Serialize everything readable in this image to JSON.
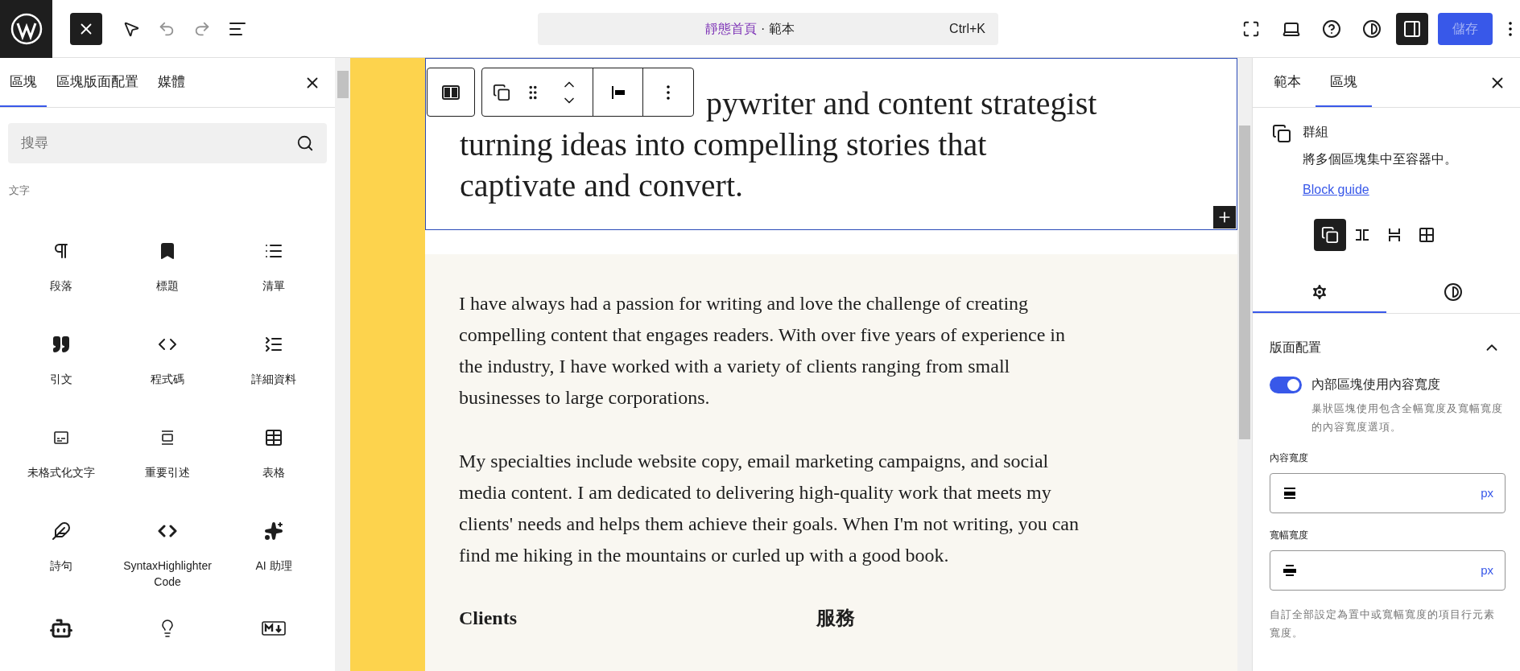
{
  "top_bar": {
    "command": {
      "page": "靜態首頁",
      "separator": " · ",
      "type": "範本",
      "shortcut": "Ctrl+K"
    },
    "save_button": {
      "label": "儲存",
      "disabled": true
    },
    "sidebar_open": true
  },
  "inserter": {
    "tabs": [
      {
        "label": "區塊",
        "selected": true
      },
      {
        "label": "區塊版面配置",
        "selected": false
      },
      {
        "label": "媒體",
        "selected": false
      }
    ],
    "search": {
      "placeholder": "搜尋"
    },
    "category": "文字",
    "blocks": [
      {
        "label": "段落"
      },
      {
        "label": "標題"
      },
      {
        "label": "清單"
      },
      {
        "label": "引文"
      },
      {
        "label": "程式碼"
      },
      {
        "label": "詳細資料"
      },
      {
        "label": "未格式化文字"
      },
      {
        "label": "重要引述"
      },
      {
        "label": "表格"
      },
      {
        "label": "詩句"
      },
      {
        "label": "SyntaxHighlighter Code"
      },
      {
        "label": "AI 助理"
      }
    ]
  },
  "canvas": {
    "heading_lines": [
      "pywriter and content strategist",
      "turning ideas into compelling stories that",
      "captivate and convert."
    ],
    "paragraphs": [
      "I have always had a passion for writing and love the challenge of creating compelling content that engages readers. With over five years of experience in the industry, I have worked with a variety of clients ranging from small businesses to large corporations.",
      "My specialties include website copy, email marketing campaigns, and social media content. I am dedicated to delivering high-quality work that meets my clients' needs and helps them achieve their goals. When I'm not writing, you can find me hiking in the mountains or curled up with a good book."
    ],
    "column_headings": [
      "Clients",
      "服務"
    ]
  },
  "settings": {
    "tabs": [
      {
        "label": "範本",
        "selected": false
      },
      {
        "label": "區塊",
        "selected": true
      }
    ],
    "block": {
      "title": "群組",
      "description": "將多個區塊集中至容器中。",
      "link": "Block guide"
    },
    "variations": [
      {
        "kind": "group",
        "selected": true
      },
      {
        "kind": "row",
        "selected": false
      },
      {
        "kind": "stack",
        "selected": false
      },
      {
        "kind": "grid",
        "selected": false
      }
    ],
    "panel_tabs": [
      {
        "kind": "settings",
        "selected": true
      },
      {
        "kind": "styles",
        "selected": false
      }
    ],
    "layout": {
      "title": "版面配置",
      "expanded": true,
      "toggle": {
        "label": "內部區塊使用內容寬度",
        "on": true,
        "help": "巢狀區塊使用包含全幅寬度及寬幅寬度的內容寬度選項。"
      },
      "fields": [
        {
          "label": "內容寬度",
          "kind": "content",
          "unit": "px"
        },
        {
          "label": "寬幅寬度",
          "kind": "wide",
          "unit": "px"
        }
      ],
      "help": "自訂全部設定為置中或寬幅寬度的項目行元素寬度。"
    }
  }
}
